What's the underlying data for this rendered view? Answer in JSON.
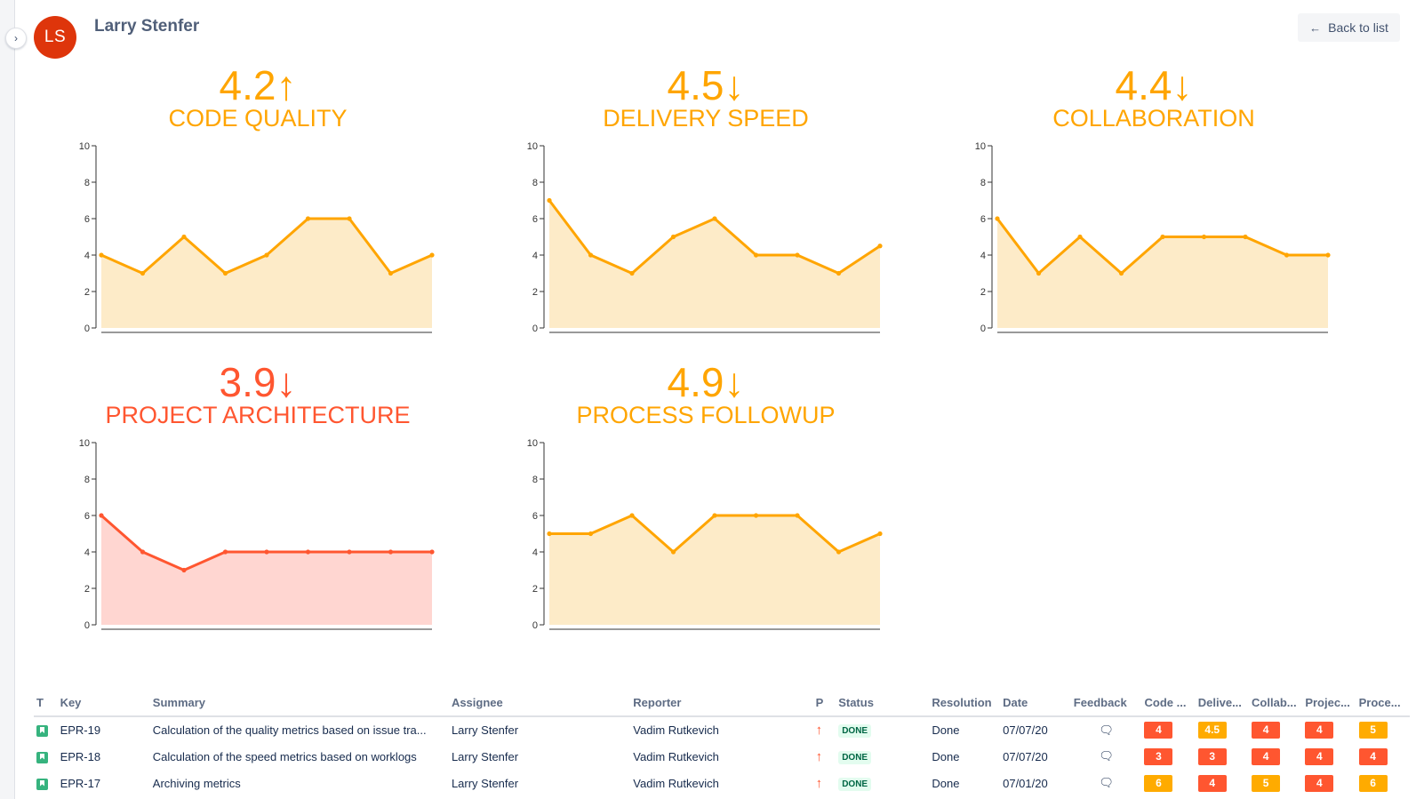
{
  "header": {
    "avatar_initials": "LS",
    "avatar_color": "#de350b",
    "user_name": "Larry Stenfer",
    "back_label": "Back to list",
    "back_icon": "arrow-left-icon",
    "expand_icon": "chevron-right-icon"
  },
  "colors": {
    "orange": "#ffa500",
    "red": "#ff5630",
    "orange_fill": "#fdebc8",
    "red_fill": "#ffd6d1"
  },
  "chart_data": [
    {
      "type": "area",
      "score": "4.2",
      "trend": "↑",
      "title": "CODE QUALITY",
      "color": "#ffa500",
      "fill": "#fdebc8",
      "ylim": [
        0,
        10
      ],
      "yticks": [
        "0",
        "2",
        "4",
        "6",
        "8",
        "10"
      ],
      "values": [
        4,
        3,
        5,
        3,
        4,
        6,
        6,
        3,
        4
      ]
    },
    {
      "type": "area",
      "score": "4.5",
      "trend": "↓",
      "title": "DELIVERY SPEED",
      "color": "#ffa500",
      "fill": "#fdebc8",
      "ylim": [
        0,
        10
      ],
      "yticks": [
        "0",
        "2",
        "4",
        "6",
        "8",
        "10"
      ],
      "values": [
        7,
        4,
        3,
        5,
        6,
        4,
        4,
        3,
        4.5
      ]
    },
    {
      "type": "area",
      "score": "4.4",
      "trend": "↓",
      "title": "COLLABORATION",
      "color": "#ffa500",
      "fill": "#fdebc8",
      "ylim": [
        0,
        10
      ],
      "yticks": [
        "0",
        "2",
        "4",
        "6",
        "8",
        "10"
      ],
      "values": [
        6,
        3,
        5,
        3,
        5,
        5,
        5,
        4,
        4
      ]
    },
    {
      "type": "area",
      "score": "3.9",
      "trend": "↓",
      "title": "PROJECT ARCHITECTURE",
      "color": "#ff5630",
      "fill": "#ffd6d1",
      "ylim": [
        0,
        10
      ],
      "yticks": [
        "0",
        "2",
        "4",
        "6",
        "8",
        "10"
      ],
      "values": [
        6,
        4,
        3,
        4,
        4,
        4,
        4,
        4,
        4
      ]
    },
    {
      "type": "area",
      "score": "4.9",
      "trend": "↓",
      "title": "PROCESS FOLLOWUP",
      "color": "#ffa500",
      "fill": "#fdebc8",
      "ylim": [
        0,
        10
      ],
      "yticks": [
        "0",
        "2",
        "4",
        "6",
        "8",
        "10"
      ],
      "values": [
        5,
        5,
        6,
        4,
        6,
        6,
        6,
        4,
        5
      ]
    }
  ],
  "table": {
    "headers": [
      "T",
      "Key",
      "Summary",
      "Assignee",
      "Reporter",
      "P",
      "Status",
      "Resolution",
      "Date",
      "Feedback",
      "Code ...",
      "Delive...",
      "Collab...",
      "Projec...",
      "Proce..."
    ],
    "rows": [
      {
        "type_icon": "story-icon",
        "key": "EPR-19",
        "summary": "Calculation of the quality metrics based on issue tra...",
        "assignee": "Larry Stenfer",
        "reporter": "Vadim Rutkevich",
        "priority_icon": "arrow-up-icon",
        "status": "DONE",
        "resolution": "Done",
        "date": "07/07/20",
        "feedback_icon": "comment-icon",
        "scores": [
          {
            "v": "4",
            "c": "#ff5630"
          },
          {
            "v": "4.5",
            "c": "#ffab00"
          },
          {
            "v": "4",
            "c": "#ff5630"
          },
          {
            "v": "4",
            "c": "#ff5630"
          },
          {
            "v": "5",
            "c": "#ffab00"
          }
        ]
      },
      {
        "type_icon": "story-icon",
        "key": "EPR-18",
        "summary": "Calculation of the speed metrics based on worklogs",
        "assignee": "Larry Stenfer",
        "reporter": "Vadim Rutkevich",
        "priority_icon": "arrow-up-icon",
        "status": "DONE",
        "resolution": "Done",
        "date": "07/07/20",
        "feedback_icon": "comment-icon",
        "scores": [
          {
            "v": "3",
            "c": "#ff5630"
          },
          {
            "v": "3",
            "c": "#ff5630"
          },
          {
            "v": "4",
            "c": "#ff5630"
          },
          {
            "v": "4",
            "c": "#ff5630"
          },
          {
            "v": "4",
            "c": "#ff5630"
          }
        ]
      },
      {
        "type_icon": "story-icon",
        "key": "EPR-17",
        "summary": "Archiving metrics",
        "assignee": "Larry Stenfer",
        "reporter": "Vadim Rutkevich",
        "priority_icon": "arrow-up-icon",
        "status": "DONE",
        "resolution": "Done",
        "date": "07/01/20",
        "feedback_icon": "comment-icon",
        "scores": [
          {
            "v": "6",
            "c": "#ffab00"
          },
          {
            "v": "4",
            "c": "#ff5630"
          },
          {
            "v": "5",
            "c": "#ffab00"
          },
          {
            "v": "4",
            "c": "#ff5630"
          },
          {
            "v": "6",
            "c": "#ffab00"
          }
        ]
      }
    ]
  }
}
